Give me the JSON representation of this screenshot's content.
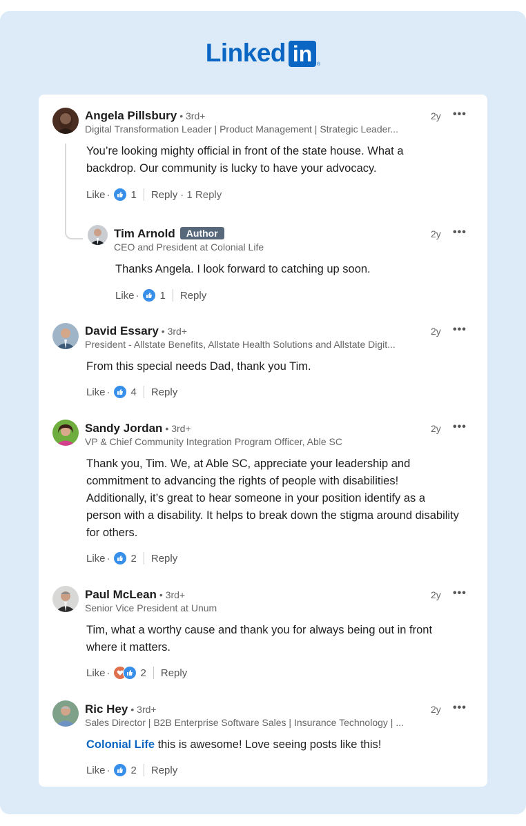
{
  "brand": {
    "word": "Linked",
    "box": "in",
    "registered": "®"
  },
  "comments": [
    {
      "name": "Angela Pillsbury",
      "degree": "• 3rd+",
      "headline": "Digital Transformation Leader | Product Management | Strategic Leader...",
      "time": "2y",
      "body": "You’re looking mighty official in front of the state house. What a backdrop. Our community is lucky to have your advocacy.",
      "like": "Like",
      "reactions": "1",
      "reply": "Reply",
      "replies": "· 1 Reply"
    },
    {
      "name": "Tim Arnold",
      "badge": "Author",
      "headline": "CEO and President at Colonial Life",
      "time": "2y",
      "body": "Thanks Angela. I look forward to catching up soon.",
      "like": "Like",
      "reactions": "1",
      "reply": "Reply"
    },
    {
      "name": "David Essary",
      "degree": "• 3rd+",
      "headline": "President - Allstate Benefits, Allstate Health Solutions and Allstate Digit...",
      "time": "2y",
      "body": "From this special needs Dad, thank you Tim.",
      "like": "Like",
      "reactions": "4",
      "reply": "Reply"
    },
    {
      "name": "Sandy Jordan",
      "degree": "• 3rd+",
      "headline": "VP & Chief Community Integration Program Officer, Able SC",
      "time": "2y",
      "body": "Thank you, Tim. We, at Able SC, appreciate your leadership and commitment to advancing the rights of people with disabilities! Additionally, it’s great to hear someone in your position identify as a person with a disability. It helps to break down the stigma around disability for others.",
      "like": "Like",
      "reactions": "2",
      "reply": "Reply"
    },
    {
      "name": "Paul McLean",
      "degree": "• 3rd+",
      "headline": "Senior Vice President at Unum",
      "time": "2y",
      "body": "Tim, what a worthy cause and thank you for always being out in front where it matters.",
      "like": "Like",
      "reactions": "2",
      "reply": "Reply"
    },
    {
      "name": "Ric Hey",
      "degree": "• 3rd+",
      "headline": "Sales Director | B2B Enterprise Software Sales | Insurance Technology | ...",
      "time": "2y",
      "mention": "Colonial Life",
      "body": " this is awesome! Love seeing posts like this!",
      "like": "Like",
      "reactions": "2",
      "reply": "Reply"
    }
  ],
  "more_icon": "more-horizontal-icon",
  "colors": {
    "brand": "#0a66c2",
    "frame": "#dcebf7",
    "like": "#378fe9",
    "love": "#df704d",
    "badge": "#56687a"
  }
}
